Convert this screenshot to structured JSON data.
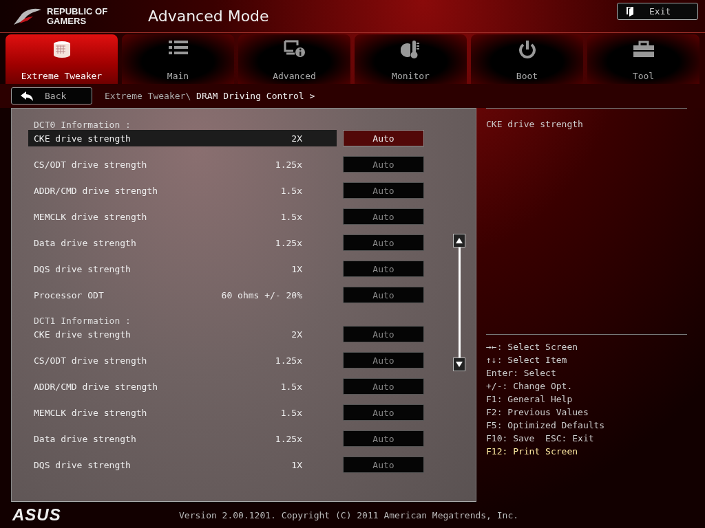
{
  "header": {
    "logo_lines": [
      "REPUBLIC OF",
      "GAMERS"
    ],
    "title": "Advanced Mode",
    "exit_button": "Exit"
  },
  "tabs": [
    {
      "label": "Extreme Tweaker",
      "selected": true
    },
    {
      "label": "Main",
      "selected": false
    },
    {
      "label": "Advanced",
      "selected": false
    },
    {
      "label": "Monitor",
      "selected": false
    },
    {
      "label": "Boot",
      "selected": false
    },
    {
      "label": "Tool",
      "selected": false
    }
  ],
  "nav": {
    "back_button": "Back",
    "breadcrumb_path": "Extreme Tweaker\\",
    "breadcrumb_current": "DRAM Driving Control >"
  },
  "sections": [
    {
      "title": "DCT0 Information :",
      "settings": [
        {
          "label": "CKE drive strength",
          "value": "2X",
          "option": "Auto",
          "selected": true
        },
        {
          "label": "CS/ODT drive strength",
          "value": "1.25x",
          "option": "Auto",
          "selected": false
        },
        {
          "label": "ADDR/CMD drive strength",
          "value": "1.5x",
          "option": "Auto",
          "selected": false
        },
        {
          "label": "MEMCLK drive strength",
          "value": "1.5x",
          "option": "Auto",
          "selected": false
        },
        {
          "label": "Data drive strength",
          "value": "1.25x",
          "option": "Auto",
          "selected": false
        },
        {
          "label": "DQS drive strength",
          "value": "1X",
          "option": "Auto",
          "selected": false
        },
        {
          "label": "Processor ODT",
          "value": "60 ohms +/- 20%",
          "option": "Auto",
          "selected": false
        }
      ]
    },
    {
      "title": "DCT1 Information :",
      "settings": [
        {
          "label": "CKE drive strength",
          "value": "2X",
          "option": "Auto",
          "selected": false
        },
        {
          "label": "CS/ODT drive strength",
          "value": "1.25x",
          "option": "Auto",
          "selected": false
        },
        {
          "label": "ADDR/CMD drive strength",
          "value": "1.5x",
          "option": "Auto",
          "selected": false
        },
        {
          "label": "MEMCLK drive strength",
          "value": "1.5x",
          "option": "Auto",
          "selected": false
        },
        {
          "label": "Data drive strength",
          "value": "1.25x",
          "option": "Auto",
          "selected": false
        },
        {
          "label": "DQS drive strength",
          "value": "1X",
          "option": "Auto",
          "selected": false
        }
      ]
    }
  ],
  "help": {
    "description": "CKE drive strength",
    "hints": [
      {
        "text": "→←: Select Screen",
        "highlighted": false
      },
      {
        "text": "↑↓: Select Item",
        "highlighted": false
      },
      {
        "text": "Enter: Select",
        "highlighted": false
      },
      {
        "text": "+/-: Change Opt.",
        "highlighted": false
      },
      {
        "text": "F1: General Help",
        "highlighted": false
      },
      {
        "text": "F2: Previous Values",
        "highlighted": false
      },
      {
        "text": "F5: Optimized Defaults",
        "highlighted": false
      },
      {
        "text": "F10: Save  ESC: Exit",
        "highlighted": false
      },
      {
        "text": "F12: Print Screen",
        "highlighted": true
      }
    ]
  },
  "footer": {
    "brand": "ASUS",
    "version": "Version 2.00.1201. Copyright (C) 2011 American Megatrends, Inc."
  }
}
